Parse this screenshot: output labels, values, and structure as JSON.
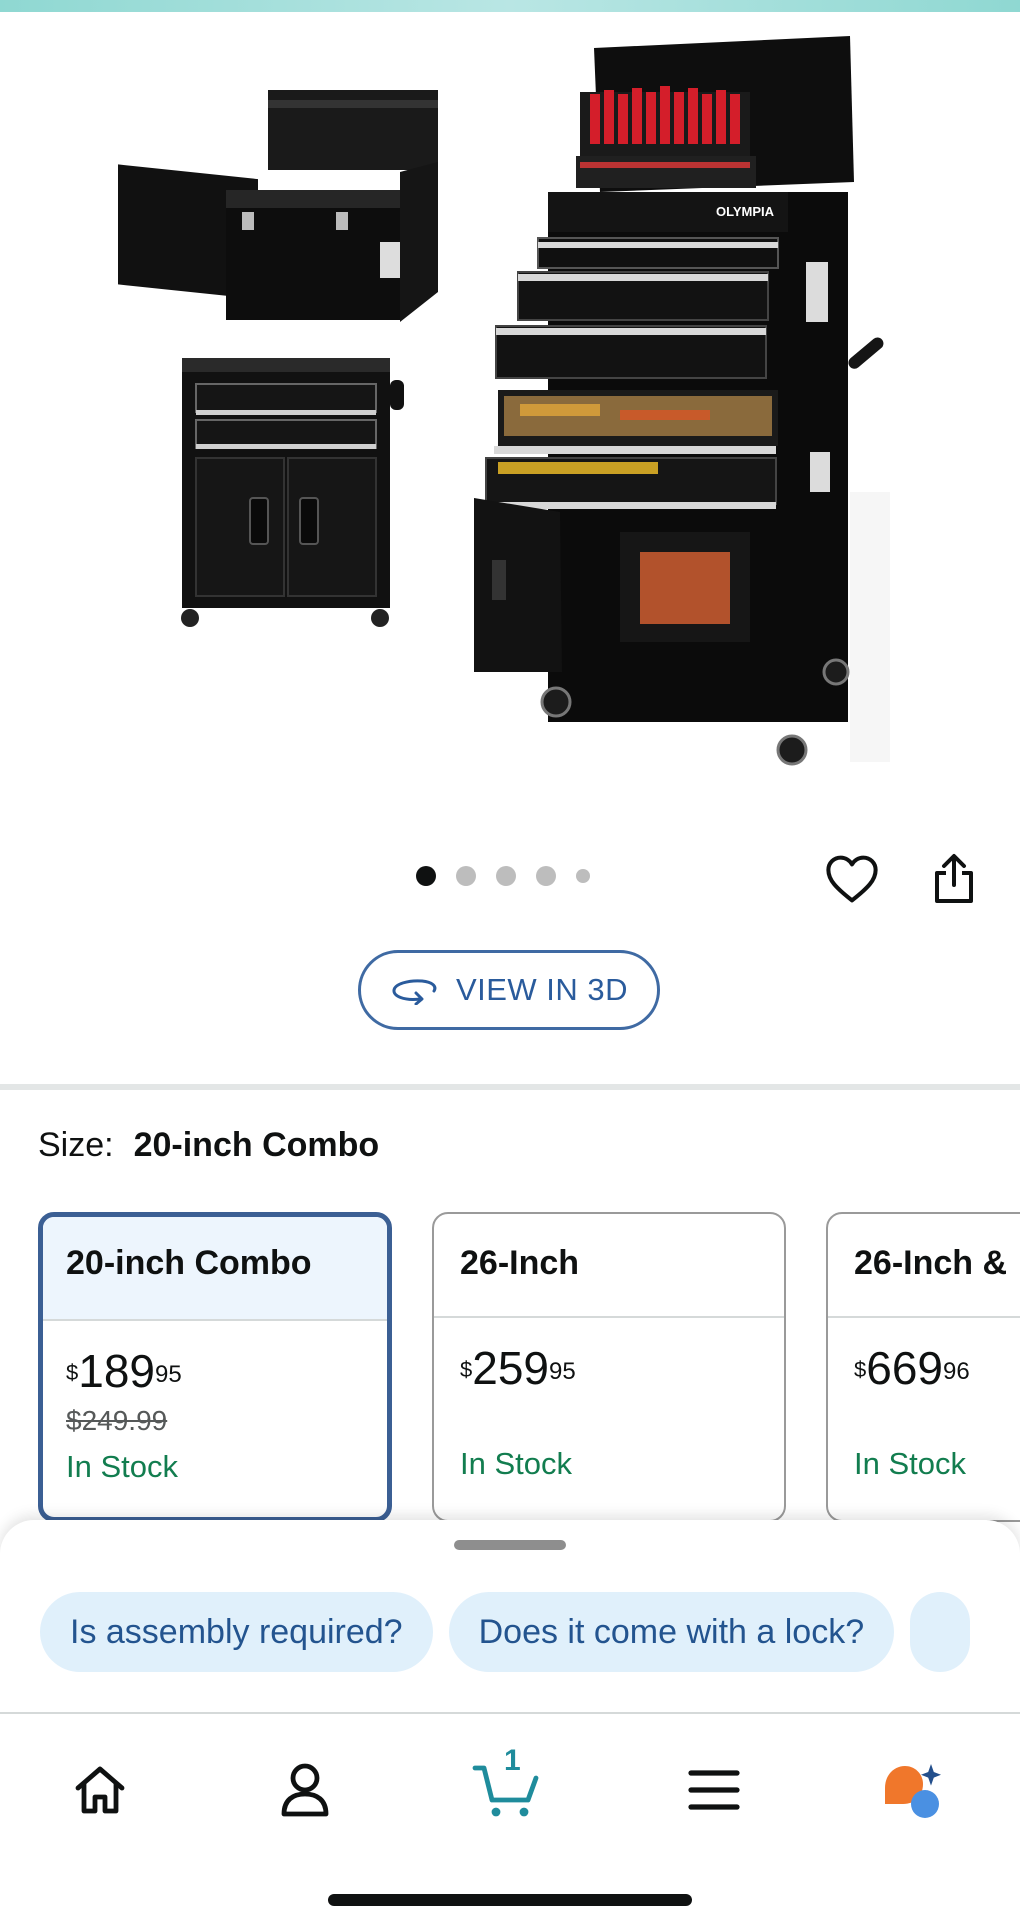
{
  "gallery": {
    "brand_label": "OLYMPIA",
    "dots_total": 5,
    "active_dot": 0
  },
  "actions": {
    "wishlist_icon": "heart-outline-icon",
    "share_icon": "share-icon"
  },
  "view3d": {
    "label": "VIEW IN 3D",
    "icon": "rotate-3d-icon"
  },
  "size": {
    "label": "Size:",
    "selected": "20-inch Combo"
  },
  "options": [
    {
      "name": "20-inch Combo",
      "currency": "$",
      "whole": "189",
      "fraction": "95",
      "was": "$249.99",
      "stock": "In Stock",
      "selected": true
    },
    {
      "name": "26-Inch",
      "currency": "$",
      "whole": "259",
      "fraction": "95",
      "was": "",
      "stock": "In Stock",
      "selected": false
    },
    {
      "name": "26-Inch &",
      "currency": "$",
      "whole": "669",
      "fraction": "96",
      "was": "",
      "stock": "In Stock",
      "selected": false
    }
  ],
  "questions": [
    "Is assembly required?",
    "Does it come with a lock?"
  ],
  "nav": {
    "items": [
      "home-icon",
      "account-icon",
      "cart-icon",
      "menu-icon",
      "rufus-assistant-icon"
    ],
    "cart_count": "1"
  },
  "colors": {
    "accent_blue": "#3b5f94",
    "link_blue": "#2a5b9c",
    "in_stock_green": "#127d4f",
    "chip_bg": "#e0f0fb",
    "cart_teal": "#1f8c9c",
    "rufus_orange": "#f0772b",
    "rufus_blue": "#4a90e2"
  }
}
